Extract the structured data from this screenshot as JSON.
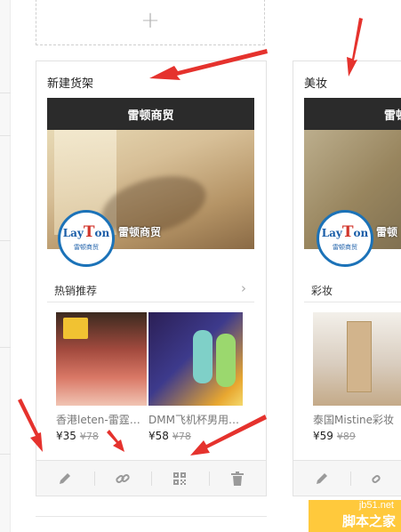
{
  "add_shelf": {
    "symbol": "+"
  },
  "shelves": [
    {
      "title": "新建货架",
      "banner": "雷顿商贸",
      "logo": {
        "text_before": "Lay",
        "text_t": "T",
        "text_after": "on",
        "sub": "雷顿商贸"
      },
      "brand_overlay": "雷顿商贸",
      "section": "热销推荐",
      "chevron": "›",
      "products": [
        {
          "name": "香港leten-雷霆男用",
          "price": "¥35",
          "old_price": "¥78"
        },
        {
          "name": "DMM飞机杯男用自慰",
          "price": "¥58",
          "old_price": "¥78"
        }
      ]
    },
    {
      "title": "美妆",
      "banner": "雷顿",
      "logo": {
        "text_before": "Lay",
        "text_t": "T",
        "text_after": "on",
        "sub": "雷顿商贸"
      },
      "brand_overlay": "雷顿",
      "section": "彩妆",
      "products": [
        {
          "name": "泰国Mistine彩妆",
          "price": "¥59",
          "old_price": "¥89"
        }
      ]
    }
  ],
  "watermark": {
    "url": "jb51.net",
    "name": "脚本之家"
  },
  "colors": {
    "arrow": "#e5322d",
    "logo_blue": "#1b72b8",
    "banner": "#2b2b2b",
    "watermark": "#ffc93c"
  }
}
